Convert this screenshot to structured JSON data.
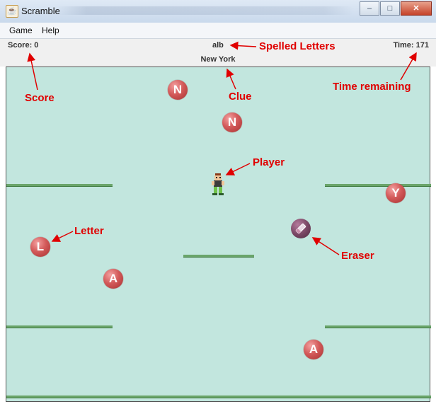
{
  "window": {
    "title": "Scramble",
    "buttons": {
      "minimize": "–",
      "maximize": "□",
      "close": "✕"
    }
  },
  "menu": {
    "items": [
      "Game",
      "Help"
    ]
  },
  "status": {
    "score": "Score: 0",
    "spelled": "alb",
    "time": "Time: 171",
    "clue": "New York"
  },
  "game": {
    "letters": [
      "N",
      "N",
      "Y",
      "L",
      "A",
      "A"
    ]
  },
  "annotations": {
    "spelled_letters": "Spelled Letters",
    "score": "Score",
    "clue": "Clue",
    "time_remaining": "Time remaining",
    "player": "Player",
    "letter": "Letter",
    "eraser": "Eraser"
  },
  "colors": {
    "game_background": "#c2e6de",
    "platform": "#6aa56a",
    "letter_ball": "#d35a5a",
    "eraser_ball": "#7c4866",
    "annotation": "#e00000"
  }
}
